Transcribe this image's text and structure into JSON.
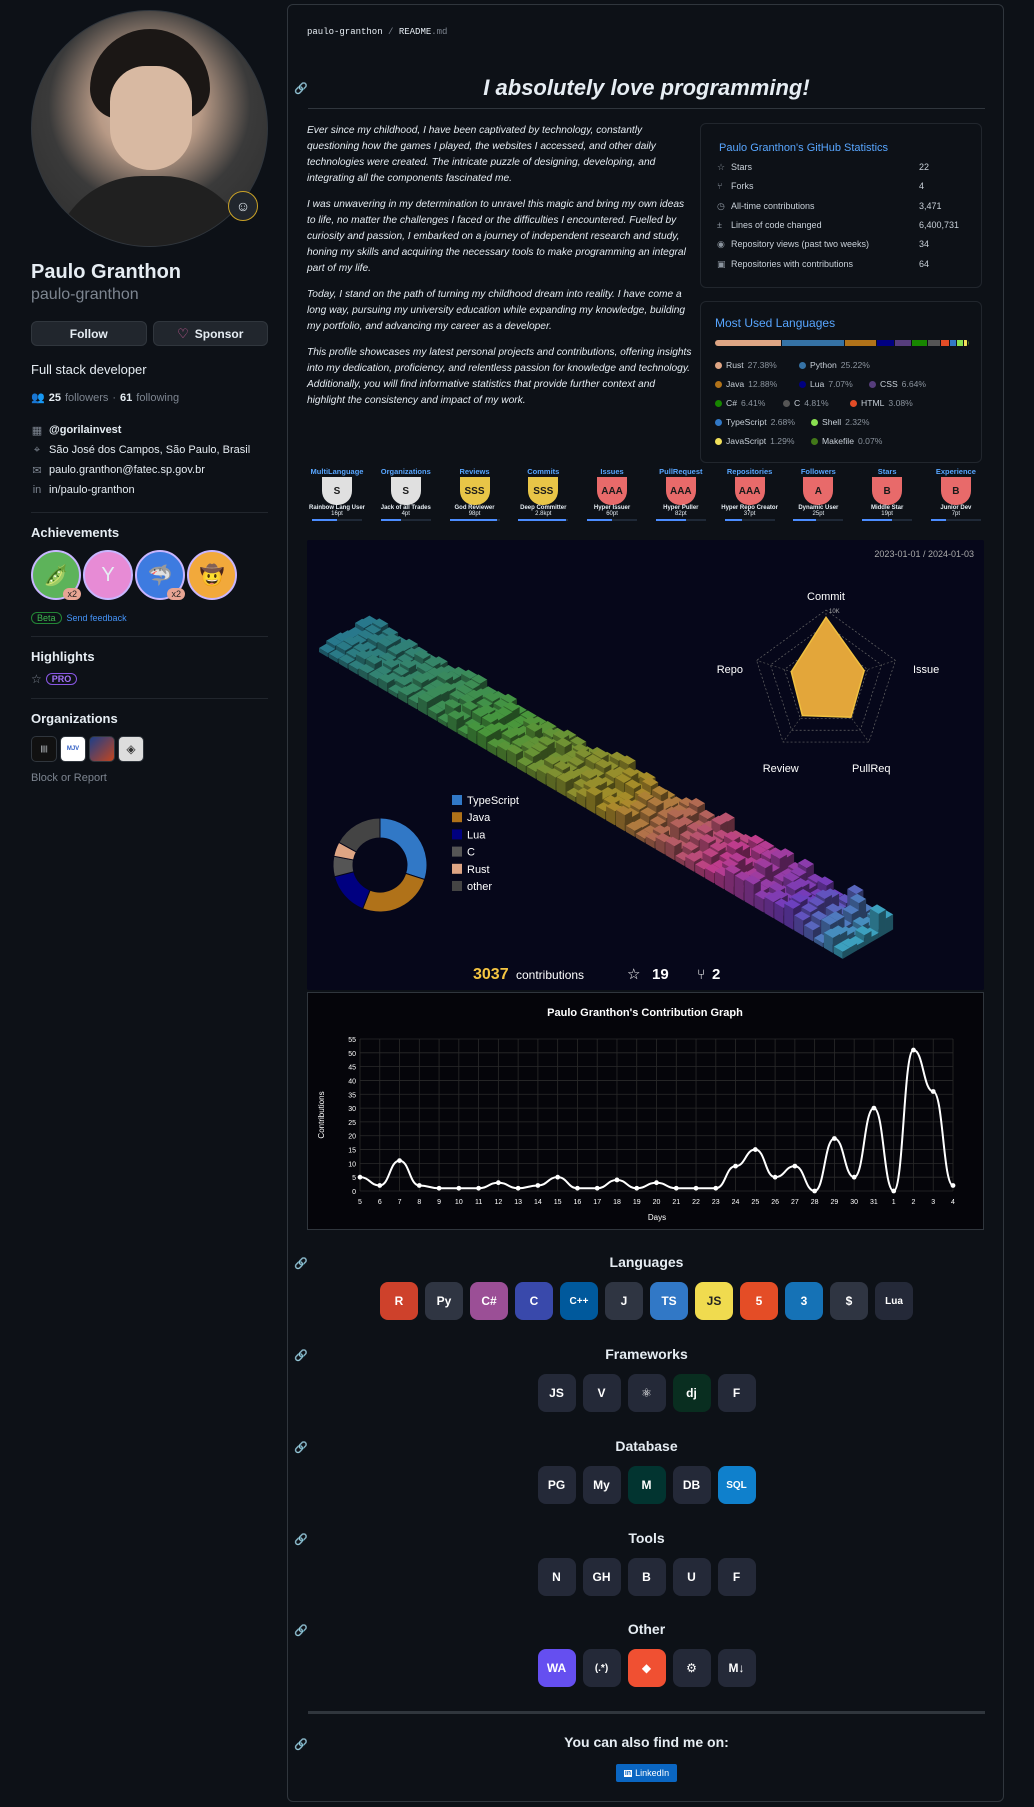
{
  "profile": {
    "name": "Paulo Granthon",
    "login": "paulo-granthon",
    "follow_label": "Follow",
    "sponsor_label": "Sponsor",
    "bio": "Full stack developer",
    "followers_count": "25",
    "followers_label": "followers",
    "following_count": "61",
    "following_label": "following",
    "company": "@gorilainvest",
    "location": "São José dos Campos, São Paulo, Brasil",
    "email": "paulo.granthon@fatec.sp.gov.br",
    "linkedin": "in/paulo-granthon"
  },
  "achievements": {
    "title": "Achievements",
    "items": [
      {
        "icon": "pair-extraordinaire-icon",
        "mult": "x2",
        "color": "#5db35a"
      },
      {
        "icon": "yolo-icon",
        "mult": "",
        "color": "#e78bd5"
      },
      {
        "icon": "shark-icon",
        "mult": "x2",
        "color": "#3d7be0"
      },
      {
        "icon": "quickdraw-icon",
        "mult": "",
        "color": "#f2a93b"
      }
    ],
    "beta": "Beta",
    "feedback": "Send feedback"
  },
  "highlights": {
    "title": "Highlights",
    "pro": "PRO"
  },
  "organizations": {
    "title": "Organizations",
    "items": [
      "org-1",
      "org-2",
      "org-3",
      "org-4"
    ],
    "block": "Block or Report"
  },
  "readme": {
    "owner": "paulo-granthon",
    "file": "README",
    "ext": ".md",
    "heading": "I absolutely love programming!",
    "paragraphs": [
      "Ever since my childhood, I have been captivated by technology, constantly questioning how the games I played, the websites I accessed, and other daily technologies were created. The intricate puzzle of designing, developing, and integrating all the components fascinated me.",
      "I was unwavering in my determination to unravel this magic and bring my own ideas to life, no matter the challenges I faced or the difficulties I encountered. Fuelled by curiosity and passion, I embarked on a journey of independent research and study, honing my skills and acquiring the necessary tools to make programming an integral part of my life.",
      "Today, I stand on the path of turning my childhood dream into reality. I have come a long way, pursuing my university education while expanding my knowledge, building my portfolio, and advancing my career as a developer.",
      "This profile showcases my latest personal projects and contributions, offering insights into my dedication, proficiency, and relentless passion for knowledge and technology. Additionally, you will find informative statistics that provide further context and highlight the consistency and impact of my work."
    ]
  },
  "stats": {
    "title": "Paulo Granthon's GitHub Statistics",
    "rows": [
      {
        "icon": "star-icon",
        "label": "Stars",
        "value": "22"
      },
      {
        "icon": "fork-icon",
        "label": "Forks",
        "value": "4"
      },
      {
        "icon": "commit-icon",
        "label": "All-time contributions",
        "value": "3,471"
      },
      {
        "icon": "diff-icon",
        "label": "Lines of code changed",
        "value": "6,400,731"
      },
      {
        "icon": "eye-icon",
        "label": "Repository views (past two weeks)",
        "value": "34"
      },
      {
        "icon": "repo-icon",
        "label": "Repositories with contributions",
        "value": "64"
      }
    ]
  },
  "languages_card": {
    "title": "Most Used Languages",
    "items": [
      {
        "name": "Rust",
        "pct": "27.38%",
        "color": "#dea584",
        "value": 27.38
      },
      {
        "name": "Python",
        "pct": "25.22%",
        "color": "#3572a5",
        "value": 25.22
      },
      {
        "name": "Java",
        "pct": "12.88%",
        "color": "#b07219",
        "value": 12.88
      },
      {
        "name": "Lua",
        "pct": "7.07%",
        "color": "#000080",
        "value": 7.07
      },
      {
        "name": "CSS",
        "pct": "6.64%",
        "color": "#563d7c",
        "value": 6.64
      },
      {
        "name": "C#",
        "pct": "6.41%",
        "color": "#178600",
        "value": 6.41
      },
      {
        "name": "C",
        "pct": "4.81%",
        "color": "#555555",
        "value": 4.81
      },
      {
        "name": "HTML",
        "pct": "3.08%",
        "color": "#e34c26",
        "value": 3.08
      },
      {
        "name": "TypeScript",
        "pct": "2.68%",
        "color": "#3178c6",
        "value": 2.68
      },
      {
        "name": "Shell",
        "pct": "2.32%",
        "color": "#89e051",
        "value": 2.32
      },
      {
        "name": "JavaScript",
        "pct": "1.29%",
        "color": "#f1e05a",
        "value": 1.29
      },
      {
        "name": "Makefile",
        "pct": "0.07%",
        "color": "#427819",
        "value": 0.07
      }
    ]
  },
  "trophies": [
    {
      "cat": "MultiLanguage",
      "rank": "S",
      "name": "Rainbow Lang User",
      "pt": "16pt",
      "progress": 0.5,
      "color": "#e0e0e0"
    },
    {
      "cat": "Organizations",
      "rank": "S",
      "name": "Jack of all Trades",
      "pt": "4pt",
      "progress": 0.4,
      "color": "#e0e0e0"
    },
    {
      "cat": "Reviews",
      "rank": "SSS",
      "name": "God Reviewer",
      "pt": "98pt",
      "progress": 0.95,
      "color": "#e8c547"
    },
    {
      "cat": "Commits",
      "rank": "SSS",
      "name": "Deep Committer",
      "pt": "2.8kpt",
      "progress": 0.95,
      "color": "#e8c547"
    },
    {
      "cat": "Issues",
      "rank": "AAA",
      "name": "Hyper Issuer",
      "pt": "60pt",
      "progress": 0.5,
      "color": "#e86a6a"
    },
    {
      "cat": "PullRequest",
      "rank": "AAA",
      "name": "Hyper Puller",
      "pt": "82pt",
      "progress": 0.6,
      "color": "#e86a6a"
    },
    {
      "cat": "Repositories",
      "rank": "AAA",
      "name": "Hyper Repo Creator",
      "pt": "37pt",
      "progress": 0.35,
      "color": "#e86a6a"
    },
    {
      "cat": "Followers",
      "rank": "A",
      "name": "Dynamic User",
      "pt": "25pt",
      "progress": 0.45,
      "color": "#e86a6a"
    },
    {
      "cat": "Stars",
      "rank": "B",
      "name": "Middle Star",
      "pt": "19pt",
      "progress": 0.6,
      "color": "#e86a6a"
    },
    {
      "cat": "Experience",
      "rank": "B",
      "name": "Junior Dev",
      "pt": "7pt",
      "progress": 0.3,
      "color": "#e86a6a"
    }
  ],
  "iso": {
    "range": "2023-01-01 / 2024-01-03",
    "contributions": "3037",
    "contributions_label": "contributions",
    "stars": "19",
    "forks": "2",
    "radar_labels": [
      "Commit",
      "Issue",
      "PullReq",
      "Review",
      "Repo"
    ],
    "radar_max": "10K",
    "radar_values": [
      0.9,
      0.55,
      0.58,
      0.55,
      0.5
    ],
    "donut": [
      {
        "name": "TypeScript",
        "value": 30,
        "color": "#3178c6"
      },
      {
        "name": "Java",
        "value": 26,
        "color": "#b07219"
      },
      {
        "name": "Lua",
        "value": 15,
        "color": "#000080"
      },
      {
        "name": "C",
        "value": 7,
        "color": "#555555"
      },
      {
        "name": "Rust",
        "value": 5,
        "color": "#dea584"
      },
      {
        "name": "other",
        "value": 17,
        "color": "#444444"
      }
    ]
  },
  "chart_data": {
    "type": "line",
    "title": "Paulo Granthon's Contribution Graph",
    "xlabel": "Days",
    "ylabel": "Contributions",
    "x": [
      "5",
      "6",
      "7",
      "8",
      "9",
      "10",
      "11",
      "12",
      "13",
      "14",
      "15",
      "16",
      "17",
      "18",
      "19",
      "20",
      "21",
      "22",
      "23",
      "24",
      "25",
      "26",
      "27",
      "28",
      "29",
      "30",
      "31",
      "1",
      "2",
      "3",
      "4"
    ],
    "values": [
      5,
      2,
      11,
      2,
      1,
      1,
      1,
      3,
      1,
      2,
      5,
      1,
      1,
      4,
      1,
      3,
      1,
      1,
      1,
      9,
      15,
      5,
      9,
      0,
      19,
      5,
      30,
      0,
      51,
      36,
      2
    ],
    "ylim": [
      0,
      55
    ],
    "yticks": [
      "0",
      "5",
      "10",
      "15",
      "20",
      "25",
      "30",
      "35",
      "40",
      "45",
      "50",
      "55"
    ],
    "grid": true
  },
  "sections": {
    "languages": {
      "title": "Languages",
      "icons": [
        {
          "name": "rust-icon",
          "glyph": "R",
          "bg": "#ce412b"
        },
        {
          "name": "python-icon",
          "glyph": "Py",
          "bg": "#2f3542"
        },
        {
          "name": "csharp-icon",
          "glyph": "C#",
          "bg": "#9b4f96"
        },
        {
          "name": "c-icon",
          "glyph": "C",
          "bg": "#3949ab"
        },
        {
          "name": "cpp-icon",
          "glyph": "C++",
          "bg": "#00599c"
        },
        {
          "name": "java-icon",
          "glyph": "J",
          "bg": "#2f3542"
        },
        {
          "name": "typescript-icon",
          "glyph": "TS",
          "bg": "#3178c6"
        },
        {
          "name": "javascript-icon",
          "glyph": "JS",
          "bg": "#f0db4f"
        },
        {
          "name": "html-icon",
          "glyph": "5",
          "bg": "#e44d26"
        },
        {
          "name": "css-icon",
          "glyph": "3",
          "bg": "#1572b6"
        },
        {
          "name": "bash-icon",
          "glyph": "$",
          "bg": "#2f3542"
        },
        {
          "name": "lua-icon",
          "glyph": "Lua",
          "bg": "#242938"
        }
      ]
    },
    "frameworks": {
      "title": "Frameworks",
      "icons": [
        {
          "name": "nodejs-icon",
          "glyph": "JS",
          "bg": "#242938"
        },
        {
          "name": "vue-icon",
          "glyph": "V",
          "bg": "#242938"
        },
        {
          "name": "react-icon",
          "glyph": "⚛",
          "bg": "#242938"
        },
        {
          "name": "django-icon",
          "glyph": "dj",
          "bg": "#092e20"
        },
        {
          "name": "flask-icon",
          "glyph": "F",
          "bg": "#242938"
        }
      ]
    },
    "database": {
      "title": "Database",
      "icons": [
        {
          "name": "postgresql-icon",
          "glyph": "PG",
          "bg": "#242938"
        },
        {
          "name": "mysql-icon",
          "glyph": "My",
          "bg": "#242938"
        },
        {
          "name": "mongodb-icon",
          "glyph": "M",
          "bg": "#023430"
        },
        {
          "name": "oracle-db-icon",
          "glyph": "DB",
          "bg": "#242938"
        },
        {
          "name": "sqlite-icon",
          "glyph": "SQL",
          "bg": "#0f80cc"
        }
      ]
    },
    "tools": {
      "title": "Tools",
      "icons": [
        {
          "name": "neovim-icon",
          "glyph": "N",
          "bg": "#242938"
        },
        {
          "name": "github-icon",
          "glyph": "GH",
          "bg": "#242938"
        },
        {
          "name": "blender-icon",
          "glyph": "B",
          "bg": "#242938"
        },
        {
          "name": "unity-icon",
          "glyph": "U",
          "bg": "#242938"
        },
        {
          "name": "figma-icon",
          "glyph": "F",
          "bg": "#242938"
        }
      ]
    },
    "other": {
      "title": "Other",
      "icons": [
        {
          "name": "webassembly-icon",
          "glyph": "WA",
          "bg": "#654ff0"
        },
        {
          "name": "regex-icon",
          "glyph": "(.*)",
          "bg": "#242938"
        },
        {
          "name": "git-icon",
          "glyph": "◆",
          "bg": "#f05032"
        },
        {
          "name": "github-actions-icon",
          "glyph": "⚙",
          "bg": "#242938"
        },
        {
          "name": "markdown-icon",
          "glyph": "M↓",
          "bg": "#242938"
        }
      ]
    }
  },
  "footer": {
    "title": "You can also find me on:",
    "linkedin": "LinkedIn"
  }
}
